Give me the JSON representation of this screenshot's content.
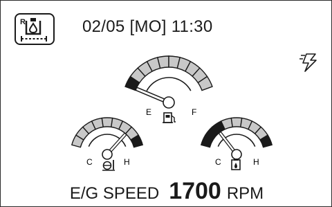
{
  "header": {
    "datetime": "02/05 [MO] 11:30",
    "mode_icon": "hydraulic-oil-mode-icon",
    "mode_letter": "R",
    "comm_icon": "lightning-signal-icon"
  },
  "gauges": {
    "fuel": {
      "icon": "fuel-pump-icon",
      "low_label": "E",
      "high_label": "F",
      "level": 0.02,
      "segments": 10,
      "red_segments": [
        0
      ]
    },
    "coolant": {
      "icon": "coolant-temperature-icon",
      "low_label": "C",
      "high_label": "H",
      "level": 0.78,
      "segments": 9,
      "red_segments": [
        8
      ]
    },
    "hydraulic": {
      "icon": "hydraulic-oil-temperature-icon",
      "low_label": "C",
      "high_label": "H",
      "level": 0.25,
      "segments": 9,
      "red_segments": [
        0,
        1,
        2,
        8
      ]
    }
  },
  "engine": {
    "label": "E/G SPEED",
    "value": "1700",
    "unit": "RPM"
  },
  "colors": {
    "segment_fill": "#c8c8c8",
    "segment_red": "#1a1a1a",
    "stroke": "#1a1a1a"
  }
}
